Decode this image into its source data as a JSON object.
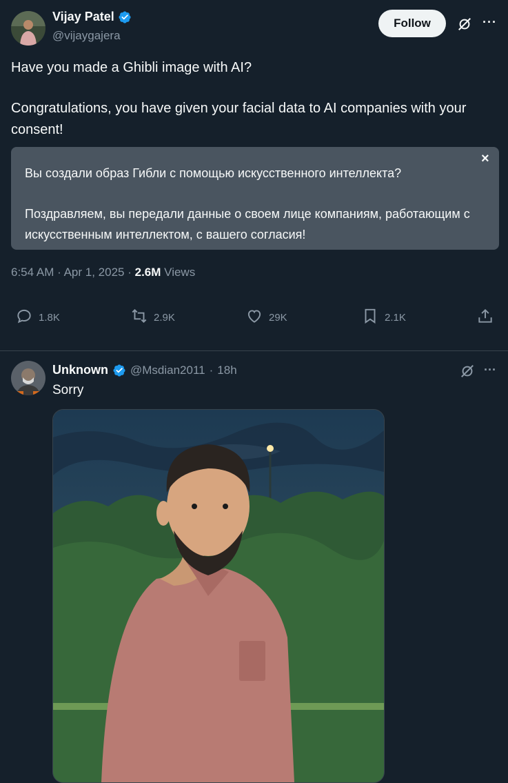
{
  "tweet": {
    "author_name": "Vijay Patel",
    "author_handle": "@vijaygajera",
    "follow_label": "Follow",
    "text_line1": "Have you made a Ghibli image with AI?",
    "text_line2": "Congratulations, you have given your facial data to AI companies with your consent!",
    "translation_line1": "Вы создали образ Гибли с помощью искусственного интеллекта?",
    "translation_line2": "Поздравляем, вы передали данные о своем лице компаниям, работающим с искусственным интеллектом, с вашего согласия!",
    "close_glyph": "×",
    "time": "6:54 AM",
    "date": "Apr 1, 2025",
    "views_count": "2.6M",
    "views_label": "Views",
    "dot": "·",
    "actions": {
      "replies": "1.8K",
      "retweets": "2.9K",
      "likes": "29K",
      "bookmarks": "2.1K"
    },
    "more_glyph": "···"
  },
  "reply": {
    "author_name": "Unknown",
    "author_handle": "@Msdian2011",
    "dot": "·",
    "age": "18h",
    "text": "Sorry",
    "more_glyph": "···"
  },
  "colors": {
    "background": "#15202b",
    "verified": "#1d9bf0",
    "muted": "#8b98a5",
    "translation_bg": "#4a5560"
  }
}
